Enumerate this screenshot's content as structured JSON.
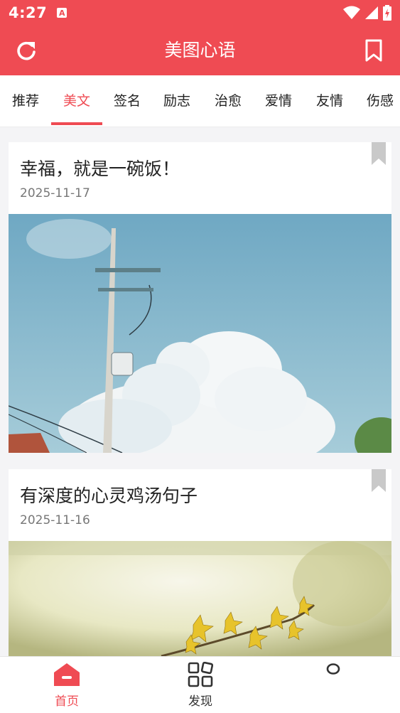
{
  "status_bar": {
    "time": "4:27",
    "notification_icon": "A"
  },
  "header": {
    "title": "美图心语"
  },
  "tabs": [
    {
      "label": "推荐"
    },
    {
      "label": "美文"
    },
    {
      "label": "签名"
    },
    {
      "label": "励志"
    },
    {
      "label": "治愈"
    },
    {
      "label": "爱情"
    },
    {
      "label": "友情"
    },
    {
      "label": "伤感"
    }
  ],
  "active_tab": "美文",
  "articles": [
    {
      "title": "幸福，就是一碗饭！",
      "date": "2025-11-17",
      "image": "sky-utility-pole-photo"
    },
    {
      "title": "有深度的心灵鸡汤句子",
      "date": "2025-11-16",
      "image": "yellow-flower-branch-photo"
    }
  ],
  "bottom_nav": {
    "items": [
      {
        "label": "首页",
        "icon": "home-icon",
        "active": true
      },
      {
        "label": "发现",
        "icon": "grid-icon",
        "active": false
      },
      {
        "label": "",
        "icon": "profile-icon",
        "active": false
      }
    ]
  },
  "colors": {
    "accent": "#ef4b53",
    "inactive": "#333333",
    "background": "#f4f4f6"
  }
}
